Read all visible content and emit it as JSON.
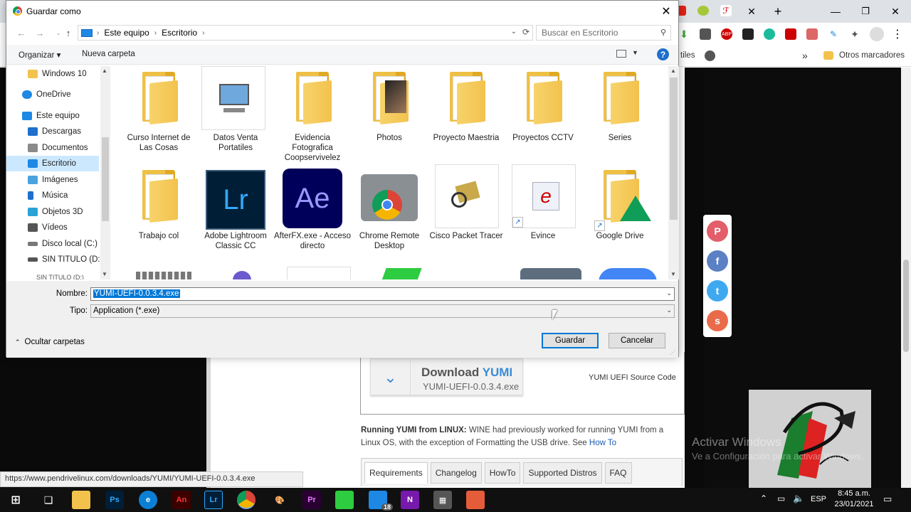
{
  "browser": {
    "bookmarks_overflow": "»",
    "other_bookmarks": "Otros marcadores",
    "bookmark_partial": "tiles",
    "status_url": "https://www.pendrivelinux.com/downloads/YUMI/YUMI-UEFI-0.0.3.4.exe"
  },
  "page": {
    "download_title_a": "Download ",
    "download_title_b": "YUMI",
    "download_file": "YUMI-UEFI-0.0.3.4.exe",
    "source_code": "YUMI UEFI Source Code",
    "linux_heading": "Running YUMI from LINUX:",
    "linux_body": " WINE had previously worked for running YUMI from a Linux OS, with the exception of Formatting the USB drive. See ",
    "linux_link": "How To",
    "tabs": [
      "Requirements",
      "Changelog",
      "HowTo",
      "Supported Distros",
      "FAQ"
    ]
  },
  "watermark": {
    "line1": "Activar Windows",
    "line2": "Ve a Configuración para activar Windows."
  },
  "dialog": {
    "title": "Guardar como",
    "breadcrumb": [
      "Este equipo",
      "Escritorio"
    ],
    "search_placeholder": "Buscar en Escritorio",
    "organize": "Organizar ▾",
    "new_folder": "Nueva carpeta",
    "help": "?",
    "tree": [
      {
        "label": "Windows 10",
        "icon": "folder-icon",
        "color": "#f3c24d"
      },
      {
        "label": "OneDrive",
        "icon": "cloud-icon",
        "color": "#1e88e5"
      },
      {
        "label": "Este equipo",
        "icon": "computer-icon",
        "color": "#1e88e5"
      },
      {
        "label": "Descargas",
        "icon": "download-icon",
        "color": "#1e6fce"
      },
      {
        "label": "Documentos",
        "icon": "document-icon",
        "color": "#8a8a8a"
      },
      {
        "label": "Escritorio",
        "icon": "desktop-icon",
        "color": "#1e88e5"
      },
      {
        "label": "Imágenes",
        "icon": "image-icon",
        "color": "#4aa3df"
      },
      {
        "label": "Música",
        "icon": "music-icon",
        "color": "#1e6fce"
      },
      {
        "label": "Objetos 3D",
        "icon": "cube-icon",
        "color": "#29a3d6"
      },
      {
        "label": "Vídeos",
        "icon": "video-icon",
        "color": "#555555"
      },
      {
        "label": "Disco local (C:)",
        "icon": "drive-icon",
        "color": "#777777"
      },
      {
        "label": "SIN TITULO (D:)",
        "icon": "drive-icon",
        "color": "#555555"
      },
      {
        "label": "SIN TITULO (D:)",
        "icon": "drive-icon",
        "color": "#555555"
      }
    ],
    "files": [
      {
        "label": "Curso Internet de Las Cosas",
        "kind": "folder"
      },
      {
        "label": "Datos Venta Portatiles",
        "kind": "computer"
      },
      {
        "label": "Evidencia Fotografica Coopservivelez",
        "kind": "folder"
      },
      {
        "label": "Photos",
        "kind": "folder"
      },
      {
        "label": "Proyecto Maestria",
        "kind": "folder"
      },
      {
        "label": "Proyectos CCTV",
        "kind": "folder"
      },
      {
        "label": "Series",
        "kind": "folder"
      },
      {
        "label": "Trabajo col",
        "kind": "folder"
      },
      {
        "label": "Adobe Lightroom Classic CC",
        "kind": "app",
        "text": "Lr",
        "bg": "#001e36",
        "fg": "#31a8ff"
      },
      {
        "label": "AfterFX.exe - Acceso directo",
        "kind": "app",
        "text": "Ae",
        "bg": "#00005b",
        "fg": "#9999ff"
      },
      {
        "label": "Chrome Remote Desktop",
        "kind": "crd"
      },
      {
        "label": "Cisco Packet Tracer",
        "kind": "cisco"
      },
      {
        "label": "Evince",
        "kind": "evince"
      },
      {
        "label": "Google Drive",
        "kind": "gdrive"
      }
    ],
    "name_label": "Nombre:",
    "name_value": "YUMI-UEFI-0.0.3.4.exe",
    "type_label": "Tipo:",
    "type_value": "Application (*.exe)",
    "hide_folders": "Ocultar carpetas",
    "save": "Guardar",
    "cancel": "Cancelar"
  },
  "taskbar": {
    "lang": "ESP",
    "time": "8:45 a.m.",
    "date": "23/01/2021",
    "badge": "18"
  }
}
